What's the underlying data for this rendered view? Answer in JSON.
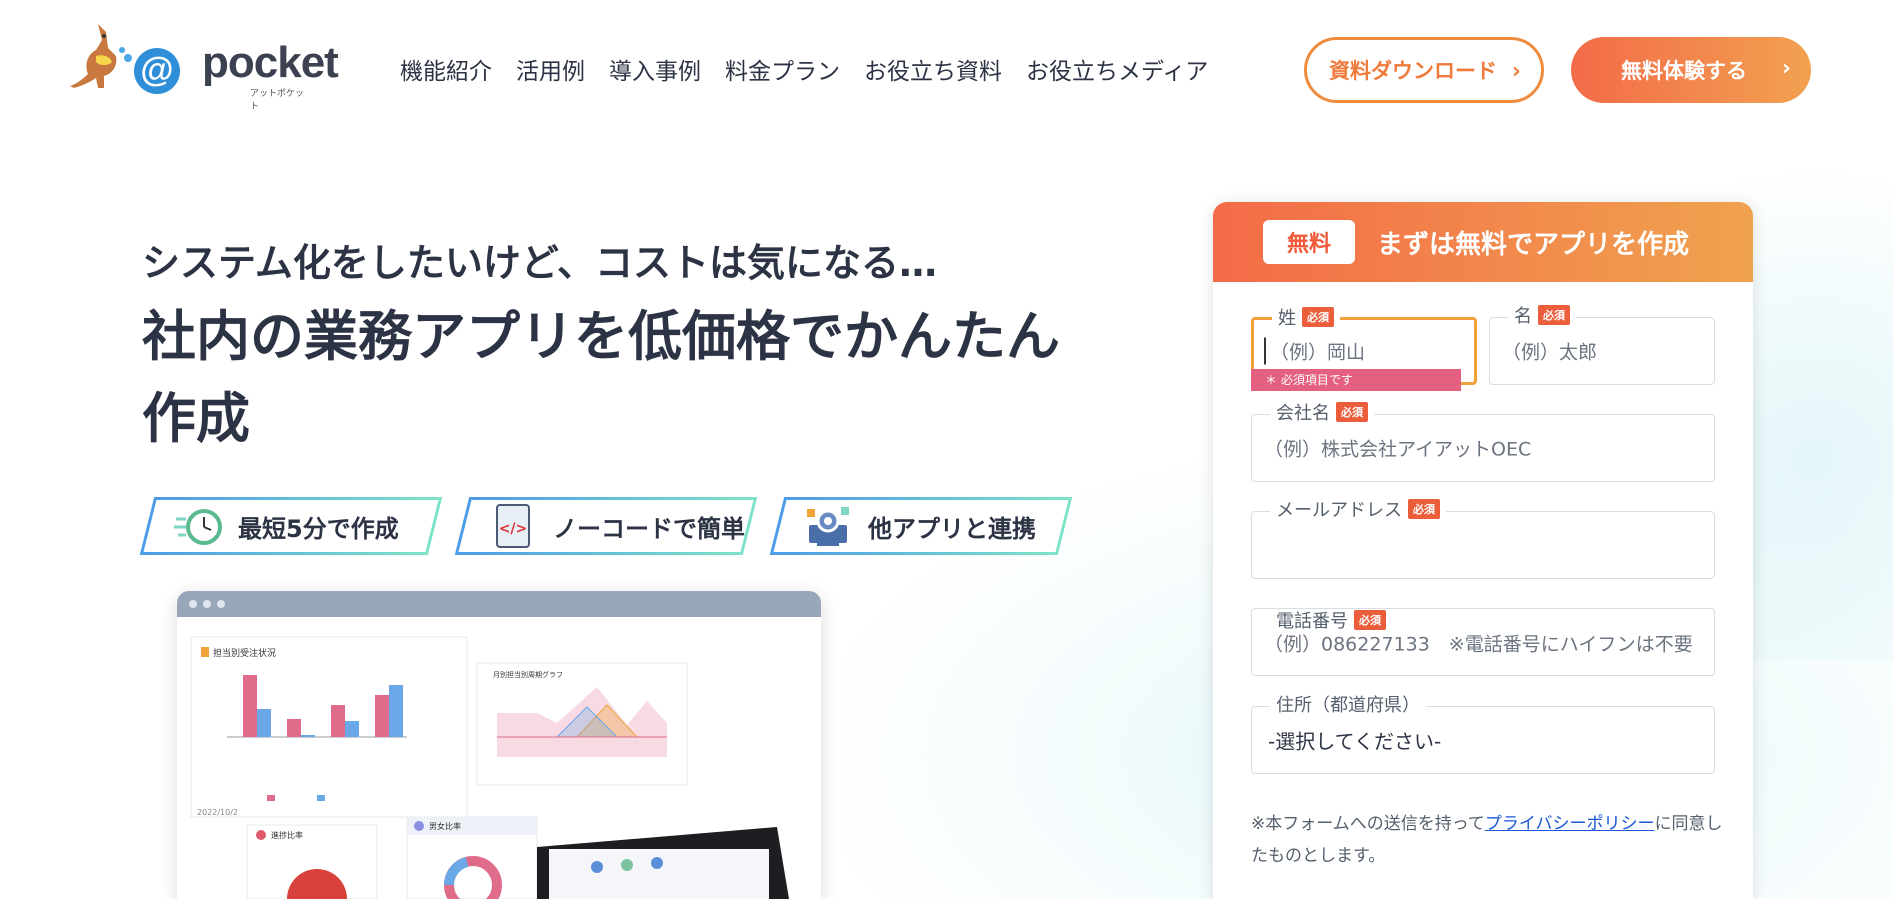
{
  "logo": {
    "text": "pocket",
    "at": "@",
    "sub": "アットポケット"
  },
  "nav": {
    "items": [
      "機能紹介",
      "活用例",
      "導入事例",
      "料金プラン",
      "お役立ち資料",
      "お役立ちメディア"
    ]
  },
  "header_buttons": {
    "download": "資料ダウンロード",
    "free_trial": "無料体験する"
  },
  "hero": {
    "sub_heading": "システム化をしたいけど、コストは気になる…",
    "main_heading": "社内の業務アプリを低価格でかんたん作成"
  },
  "features": [
    {
      "label": "最短5分で作成",
      "icon": "clock-icon"
    },
    {
      "label": "ノーコードで簡単",
      "icon": "no-code-icon"
    },
    {
      "label": "他アプリと連携",
      "icon": "integration-icon"
    }
  ],
  "dashboard": {
    "panel1_title": "担当別受注状況",
    "panel2_title": "月別担当別周期グラフ",
    "panel3_title": "進捗比率",
    "panel4_title": "男女比率",
    "date_stamp": "2022/10/2"
  },
  "form": {
    "badge": "無料",
    "title": "まずは無料でアプリを作成",
    "last_name": {
      "label": "姓",
      "placeholder": "（例）岡山",
      "required": "必須",
      "error": "＊ 必須項目です"
    },
    "first_name": {
      "label": "名",
      "placeholder": "（例）太郎",
      "required": "必須"
    },
    "company": {
      "label": "会社名",
      "placeholder": "（例）株式会社アイアットOEC",
      "required": "必須"
    },
    "email": {
      "label": "メールアドレス",
      "placeholder": "",
      "required": "必須"
    },
    "phone": {
      "label": "電話番号",
      "placeholder": "（例）086227133　※電話番号にハイフンは不要",
      "required": "必須"
    },
    "prefecture": {
      "label": "住所（都道府県）",
      "value": "-選択してください-"
    },
    "note_before": "※本フォームへの送信を持って",
    "note_link": "プライバシーポリシー",
    "note_after": "に同意したものとします。"
  },
  "colors": {
    "accent": "#f36b48",
    "accent2": "#f0a24f",
    "link": "#1a57d6",
    "error": "#e46080"
  }
}
